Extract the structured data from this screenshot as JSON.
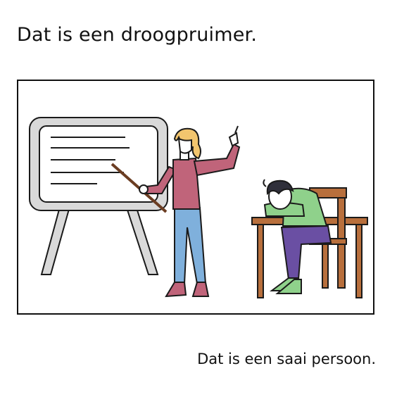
{
  "heading": "Dat is een droogpruimer.",
  "caption": "Dat is een saai persoon.",
  "illustration": {
    "subject": "classroom-presentation",
    "colors": {
      "board_frame": "#d9d9d9",
      "board_surface": "#ffffff",
      "teacher_shirt": "#c0647a",
      "teacher_pants": "#7fb0dc",
      "teacher_hair": "#f2c56e",
      "student_shirt": "#8fd18b",
      "student_pants": "#6a4fa3",
      "student_hair": "#2f2f3a",
      "desk_wood": "#b86f3c",
      "outline": "#1a1a1a"
    }
  }
}
